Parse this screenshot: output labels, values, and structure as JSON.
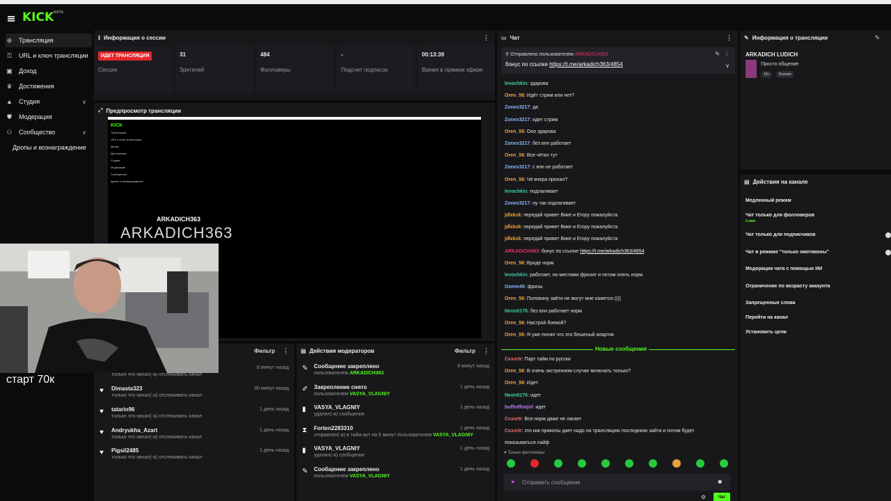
{
  "app": {
    "logo": "KICK",
    "logo_sup": "BETA"
  },
  "sidebar": {
    "items": [
      {
        "label": "Трансляция",
        "icon": "broadcast-icon"
      },
      {
        "label": "URL и ключ трансляции",
        "icon": "key-icon"
      },
      {
        "label": "Доход",
        "icon": "money-icon"
      },
      {
        "label": "Достижения",
        "icon": "trophy-icon"
      },
      {
        "label": "Студия",
        "icon": "studio-icon"
      },
      {
        "label": "Модерация",
        "icon": "shield-icon"
      },
      {
        "label": "Сообщество",
        "icon": "community-icon"
      },
      {
        "label": "Дропы и вознаграждение",
        "icon": ""
      }
    ]
  },
  "session": {
    "title": "Информация о сессии",
    "live_badge": "ИДЕТ ТРАНСЛЯЦИЯ",
    "session_label": "Сессия",
    "viewers_value": "31",
    "viewers_label": "Зрителей",
    "followers_value": "484",
    "followers_label": "Фолловеры",
    "subs_value": "-",
    "subs_label": "Подсчет подписок",
    "uptime_value": "00:13:39",
    "uptime_label": "Время в прямом эфире"
  },
  "preview": {
    "title": "Предпросмотр трансляции",
    "stream_name": "ARKADICH363",
    "big_text": "ARKADICH363",
    "mini_logo": "KICK",
    "mini_items": [
      "Трансляция",
      "URL и ключ трансляции",
      "Доход",
      "Достижения",
      "Студия",
      "Модерация",
      "Сообщество",
      "Дропы и вознаграждение"
    ]
  },
  "webcam": {
    "caption": "старт 70к"
  },
  "follows": {
    "filter": "Фильтр",
    "rows": [
      {
        "name": "",
        "sub": "только что начал(-а) отслеживать канал",
        "time": "8 минут назад"
      },
      {
        "name": "Dimasta323",
        "sub": "только что начал(-а) отслеживать канал",
        "time": "30 минут назад"
      },
      {
        "name": "tatarin96",
        "sub": "только что начал(-а) отслеживать канал",
        "time": "1 день назад"
      },
      {
        "name": "Andryukha_Azart",
        "sub": "только что начал(-а) отслеживать канал",
        "time": "1 день назад"
      },
      {
        "name": "Pigsil2485",
        "sub": "только что начал(-а) отслеживать канал",
        "time": "1 день назад"
      }
    ]
  },
  "modactions": {
    "title": "Действия модераторов",
    "filter": "Фильтр",
    "rows": [
      {
        "icon": "pin-icon",
        "glyph": "✎",
        "main": "Сообщение закреплено",
        "sub_pre": "пользователем ",
        "sub_user": "ARKADICH363",
        "time": "9 минут назад"
      },
      {
        "icon": "unpin-icon",
        "glyph": "✐",
        "main": "Закрепление снято",
        "sub_pre": "пользователем ",
        "sub_user": "VASYA_VLAGNIY",
        "time": "1 день назад"
      },
      {
        "icon": "trash-icon",
        "glyph": "▮",
        "main": "VASYA_VLAGNIY",
        "sub_pre": "удалил(-а) сообщение",
        "sub_user": "",
        "time": "1 день назад"
      },
      {
        "icon": "hourglass-icon",
        "glyph": "⧗",
        "main": "Forten2283310",
        "sub_pre": "отправлен(-а) в тайм-аут на 5 минут пользователем ",
        "sub_user": "VASYA_VLAGNIY",
        "time": "1 день назад"
      },
      {
        "icon": "trash-icon",
        "glyph": "▮",
        "main": "VASYA_VLAGNIY",
        "sub_pre": "удалил(-а) сообщение",
        "sub_user": "",
        "time": "1 день назад"
      },
      {
        "icon": "pin-icon",
        "glyph": "✎",
        "main": "Сообщение закреплено",
        "sub_pre": "пользователем ",
        "sub_user": "VASYA_VLAGNIY",
        "time": "1 день назад"
      }
    ]
  },
  "chat": {
    "title": "Чат",
    "pinned_by": "Отправлено пользователем",
    "pinned_user": "ARKADICH363",
    "pinned_text": "бонус по ссылке",
    "pinned_link": "https://t.me/arkadich363/4854",
    "messages": [
      {
        "user": "levochkin",
        "color": "#3ad1a0",
        "text": "здарова"
      },
      {
        "user": "Oren_56",
        "color": "#f2a541",
        "text": "Идёт стрим или нет?"
      },
      {
        "user": "Zonex3217",
        "color": "#8ab4f8",
        "text": "да"
      },
      {
        "user": "Zonex3217",
        "color": "#8ab4f8",
        "text": "идет стрим"
      },
      {
        "user": "Oren_56",
        "color": "#f2a541",
        "text": "Ооо здарова"
      },
      {
        "user": "Zonex3217",
        "color": "#8ab4f8",
        "text": "без впн работает"
      },
      {
        "user": "Oren_56",
        "color": "#f2a541",
        "text": "Все чётко тут"
      },
      {
        "user": "Zonex3217",
        "color": "#8ab4f8",
        "text": "с впн не работает"
      },
      {
        "user": "Oren_56",
        "color": "#f2a541",
        "text": "Чё вчера пропал?"
      },
      {
        "user": "levochkin",
        "color": "#3ad1a0",
        "text": "подлагивает"
      },
      {
        "user": "Zonex3217",
        "color": "#8ab4f8",
        "text": "ну так подлагивает"
      },
      {
        "user": "jdlxkzk",
        "color": "#f2a541",
        "text": "передай привет Вике и Егору пожалуйста"
      },
      {
        "user": "jdlxkzk",
        "color": "#f2a541",
        "text": "передай привет Вике и Егору пожалуйста"
      },
      {
        "user": "jdlxkzk",
        "color": "#f2a541",
        "text": "передай привет Вике и Егору пожалуйста"
      },
      {
        "user": "ARKADICH363",
        "color": "#e8336a",
        "text": "бонус по ссылке ",
        "link": "https://t.me/arkadich363/4854"
      },
      {
        "user": "Oren_56",
        "color": "#f2a541",
        "text": "Вроде норм"
      },
      {
        "user": "levochkin",
        "color": "#3ad1a0",
        "text": "работает, но местами фризит и потом опять норм"
      },
      {
        "user": "Ozene45",
        "color": "#8ab4f8",
        "text": "фризы"
      },
      {
        "user": "Oren_56",
        "color": "#f2a541",
        "text": "Половину зайти не могут мне кажется (((("
      },
      {
        "user": "Neon0176",
        "color": "#3ad1a0",
        "text": "без впн работает норм"
      },
      {
        "user": "Oren_56",
        "color": "#f2a541",
        "text": "Настрой боевой?"
      },
      {
        "user": "Oren_56",
        "color": "#f2a541",
        "text": "Я уже понял что это бешеный апартик"
      }
    ],
    "new_label": "Новые сообщения",
    "messages_new": [
      {
        "user": "Cxxxrtr",
        "color": "#f27272",
        "text": "Парт тайм по русски"
      },
      {
        "user": "Oren_56",
        "color": "#f2a541",
        "text": "В очень экстренном случае включать только?"
      },
      {
        "user": "Oren_56",
        "color": "#f2a541",
        "text": "Идет"
      },
      {
        "user": "Neon0176",
        "color": "#3ad1a0",
        "text": "идет"
      },
      {
        "user": "buffedfoojnl",
        "color": "#b77ef0",
        "text": "идет"
      },
      {
        "user": "Cxxxrtr",
        "color": "#f27272",
        "text": "Все норм даже не лагает"
      },
      {
        "user": "Cxxxrtr",
        "color": "#f27272",
        "text": "это кик приколы дает надо на трансляцию последнюю зайти и потом будет"
      },
      {
        "user": "",
        "color": "#e6e6e6",
        "text": "показываться лайф"
      }
    ],
    "followers_only": "Только фолловеры",
    "input_placeholder": "Отправить сообщение",
    "send_label": "Чат"
  },
  "stream_info": {
    "title": "Информация о трансляции",
    "channel": "ARKADICH LUDICH",
    "stream_title": "Просто общение",
    "tags": [
      "18+",
      "Russian"
    ]
  },
  "channel_actions": {
    "title": "Действия на канале",
    "items": [
      {
        "label": "Медленный режим",
        "sub": ""
      },
      {
        "label": "Чат только для фолловеров",
        "sub": "2 мин"
      },
      {
        "label": "Чат только для подписчиков",
        "sub": ""
      },
      {
        "label": "Чат в режиме \"только эмотиконы\"",
        "sub": ""
      },
      {
        "label": "Модерация чата с помощью ИИ",
        "sub": ""
      },
      {
        "label": "Ограничение по возрасту аккаунта",
        "sub": ""
      },
      {
        "label": "Запрещенные слова",
        "sub": ""
      },
      {
        "label": "Перейти на канал",
        "sub": ""
      },
      {
        "label": "Установить цели",
        "sub": ""
      }
    ]
  }
}
